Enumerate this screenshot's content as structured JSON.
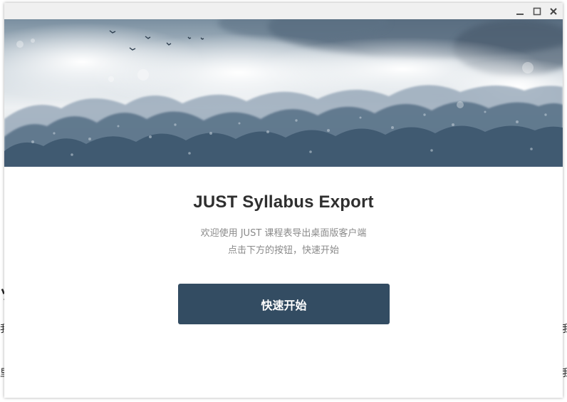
{
  "window": {
    "controls": {
      "minimize_icon": "minimize-icon",
      "maximize_icon": "maximize-icon",
      "close_icon": "close-icon"
    }
  },
  "banner": {
    "image": "misty ink-wash forest with birds",
    "icon": "landscape-banner"
  },
  "main": {
    "title": "JUST Syllabus Export",
    "subtitle_line1": "欢迎使用 JUST 课程表导出桌面版客户端",
    "subtitle_line2": "点击下方的按钮，快速开始",
    "start_button_label": "快速开始"
  },
  "colors": {
    "accent": "#334c62",
    "titlebar": "#f0f0f0",
    "title_text": "#2f2f2f",
    "subtitle_text": "#8a8a8a"
  }
}
